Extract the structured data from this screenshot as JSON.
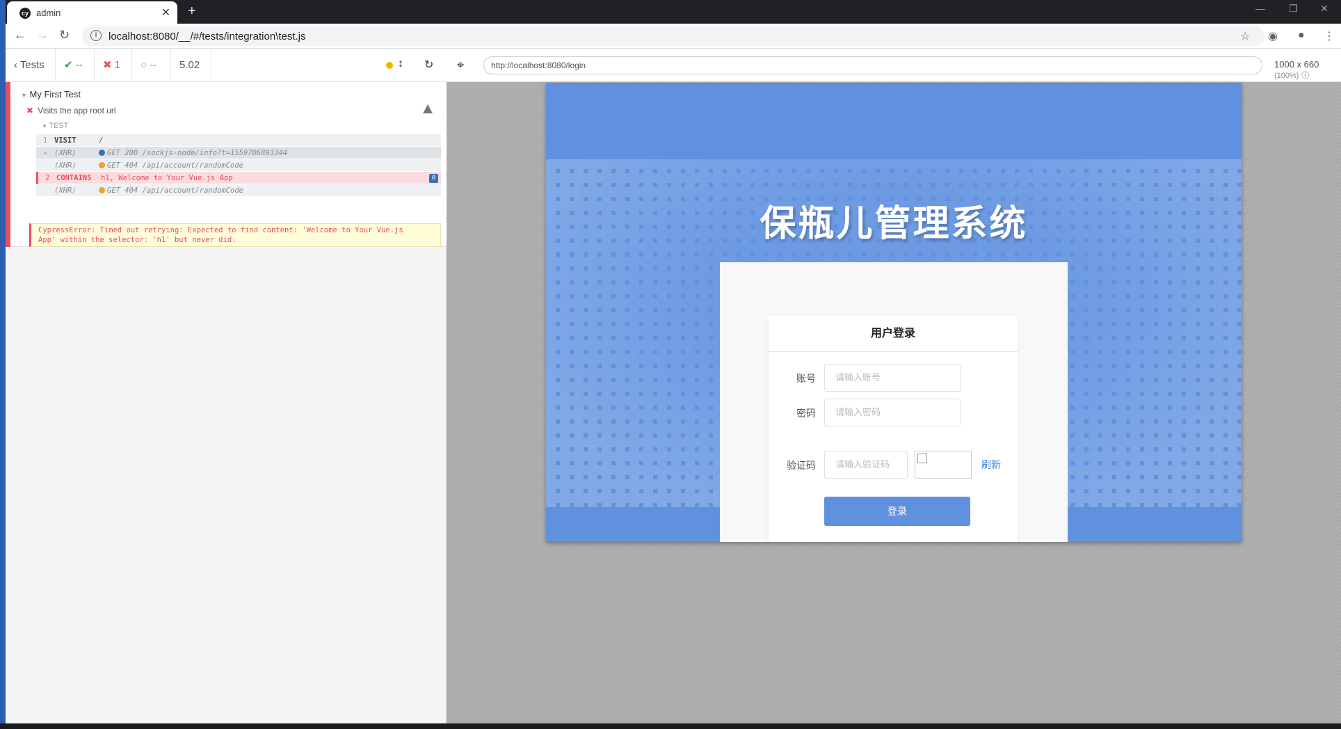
{
  "browser": {
    "tab_title": "admin",
    "url": "localhost:8080/__/#/tests/integration\\test.js"
  },
  "runner": {
    "tests_label": "Tests",
    "passed": "--",
    "failed": "1",
    "pending": "--",
    "duration": "5.02",
    "suite_title": "My First Test",
    "test_title": "Visits the app root url",
    "test_section": "TEST",
    "commands": [
      {
        "num": "1",
        "name": "VISIT",
        "message": "/",
        "type": "cmd"
      },
      {
        "num": "",
        "name": "(XHR)",
        "message": "GET 200 /sockjs-node/info?t=1559706893344",
        "type": "xhr",
        "indicator": "#3572b0",
        "pinned": true
      },
      {
        "num": "",
        "name": "(XHR)",
        "message": "GET 404 /api/account/randomCode",
        "type": "xhr",
        "indicator": "#f0a030"
      },
      {
        "num": "2",
        "name": "CONTAINS",
        "message": "h1, Welcome to Your Vue.js App",
        "type": "failed",
        "badge": "0"
      },
      {
        "num": "",
        "name": "(XHR)",
        "message": "GET 404 /api/account/randomCode",
        "type": "xhr",
        "indicator": "#f0a030"
      }
    ],
    "error_line1": "CypressError: Timed out retrying: Expected to find content: 'Welcome to Your Vue.js",
    "error_line2": "App' within the selector: 'h1' but never did."
  },
  "aut": {
    "url": "http://localhost:8080/login",
    "viewport": "1000 x 660",
    "zoom": "(100%)"
  },
  "app": {
    "system_title": "保瓶儿管理系统",
    "login_title": "用户登录",
    "account_label": "账号",
    "account_placeholder": "请输入账号",
    "password_label": "密码",
    "password_placeholder": "请输入密码",
    "captcha_label": "验证码",
    "captcha_placeholder": "请输入验证码",
    "refresh_label": "刷新",
    "login_button": "登录"
  }
}
